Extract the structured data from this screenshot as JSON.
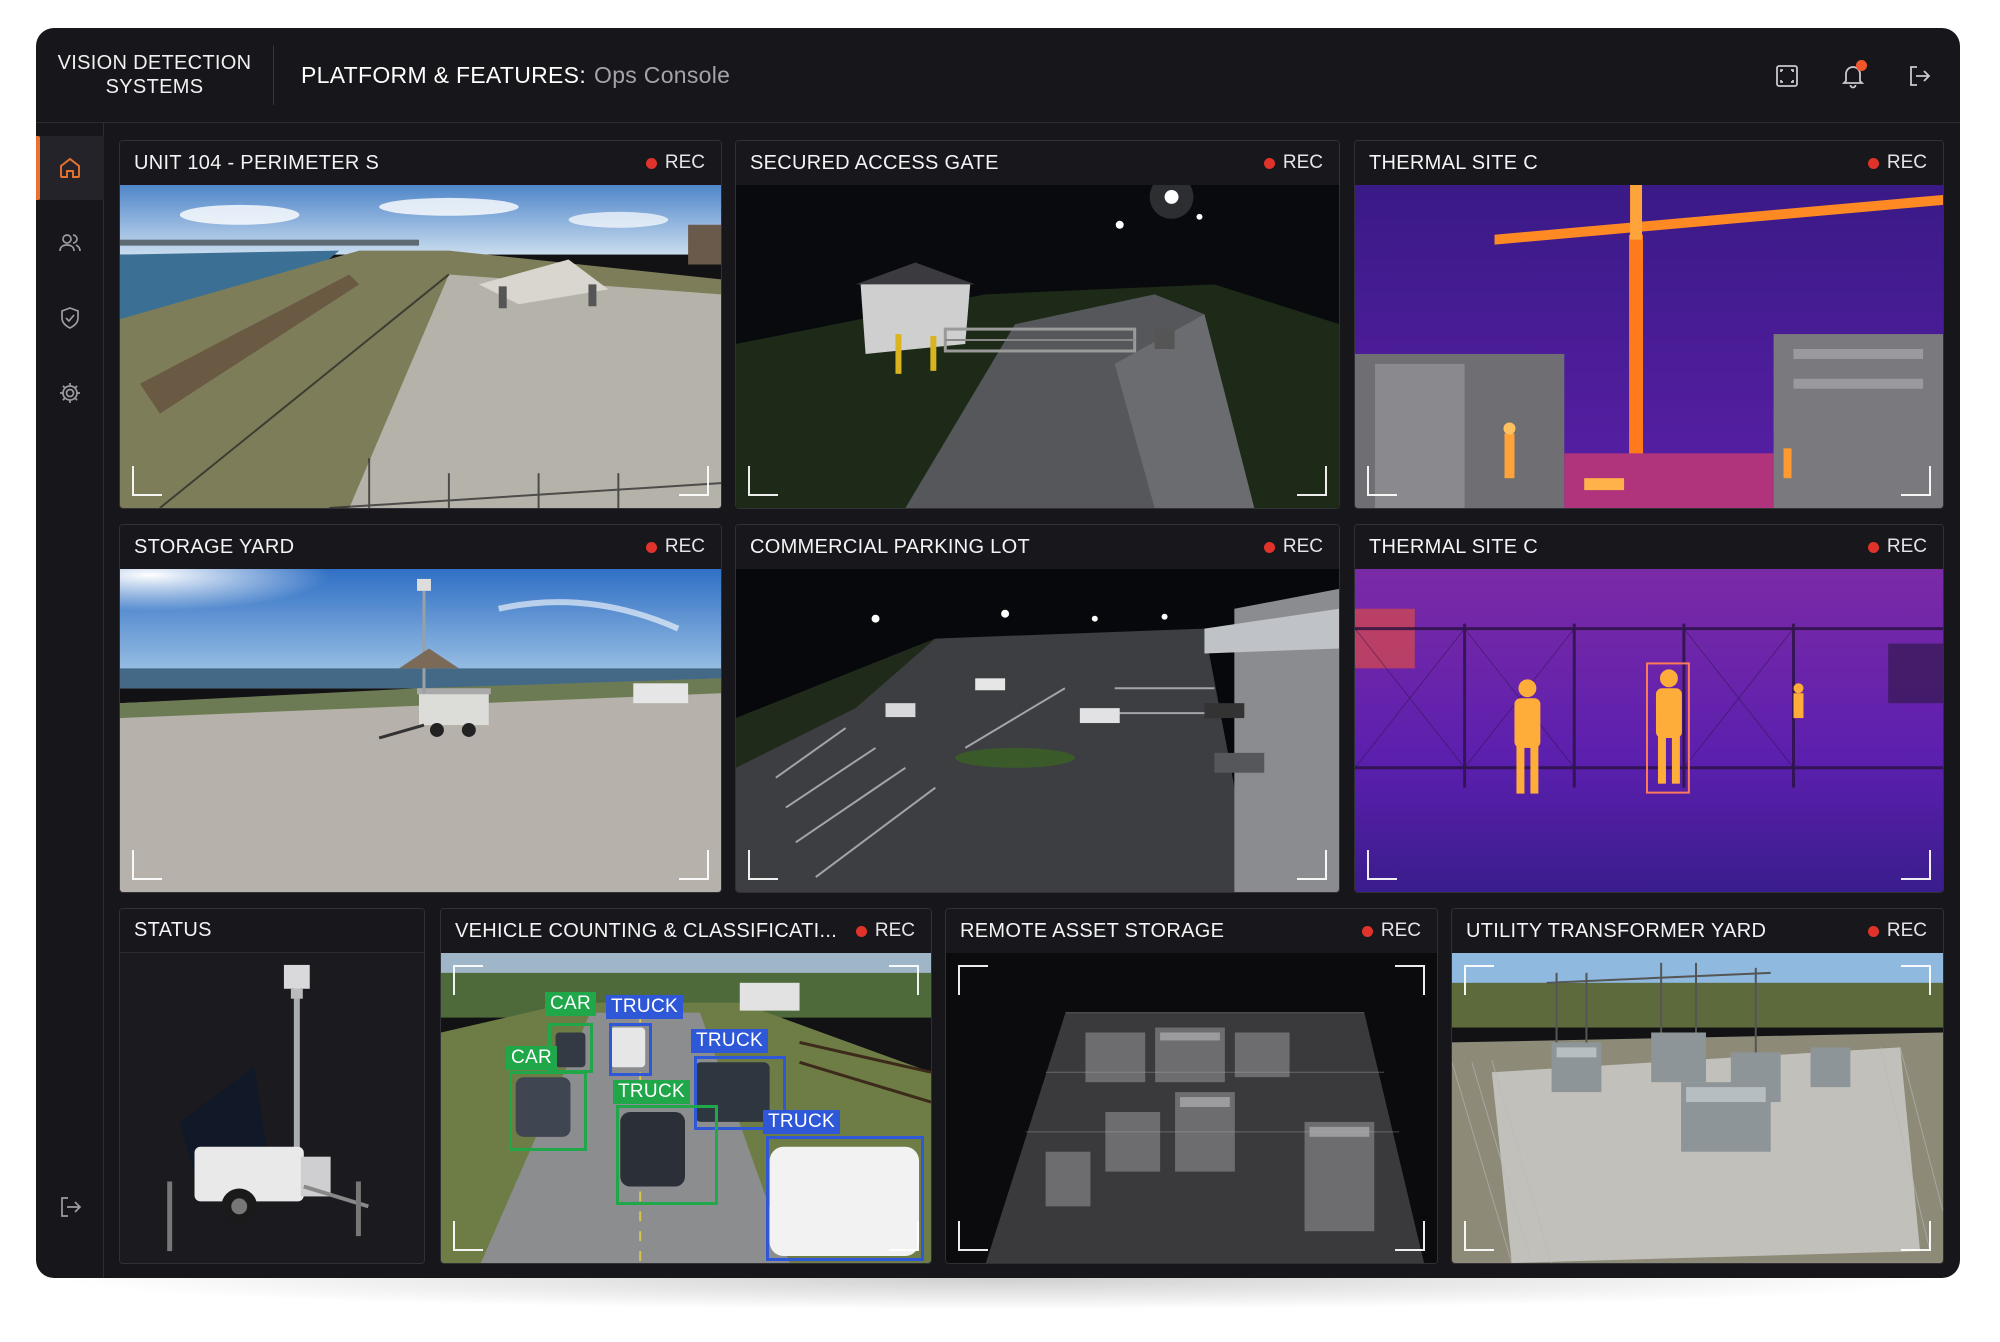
{
  "brand": {
    "line1": "VISION DETECTION",
    "line2": "SYSTEMS"
  },
  "header": {
    "title_strong": "PLATFORM & FEATURES:",
    "title_light": "Ops Console",
    "icons": [
      "fullscreen-icon",
      "bell-icon",
      "logout-icon"
    ],
    "notification_dot_color": "#f2572b"
  },
  "sidebar": {
    "items": [
      {
        "icon": "home-icon",
        "active": true
      },
      {
        "icon": "users-icon",
        "active": false
      },
      {
        "icon": "shield-icon",
        "active": false
      },
      {
        "icon": "gear-icon",
        "active": false
      }
    ],
    "bottom_icon": "logout-icon"
  },
  "accent_color": "#e8722f",
  "rec_label": "REC",
  "rec_color": "#e0332c",
  "panels": [
    {
      "title": "UNIT 104 - PERIMETER S",
      "rec": true,
      "scene": "waterfront perimeter with pavilion and fence"
    },
    {
      "title": "SECURED ACCESS GATE",
      "rec": true,
      "scene": "night access gate with guard booth"
    },
    {
      "title": "THERMAL SITE C",
      "rec": true,
      "scene": "thermal view of construction crane"
    },
    {
      "title": "STORAGE YARD",
      "rec": true,
      "scene": "gravel yard with mobile surveillance trailer"
    },
    {
      "title": "COMMERCIAL PARKING LOT",
      "rec": true,
      "scene": "night parking lot aerial view"
    },
    {
      "title": "THERMAL SITE C",
      "rec": true,
      "scene": "thermal view of people at fence"
    },
    {
      "title": "STATUS",
      "rec": false,
      "scene": "surveillance trailer unit"
    },
    {
      "title": "VEHICLE COUNTING & CLASSIFICATI...",
      "rec": true,
      "scene": "road with detected vehicles"
    },
    {
      "title": "REMOTE ASSET STORAGE",
      "rec": true,
      "scene": "night infrared storage area"
    },
    {
      "title": "UTILITY TRANSFORMER YARD",
      "rec": true,
      "scene": "electrical substation"
    }
  ],
  "detections": [
    {
      "label": "CAR",
      "class": "car",
      "color": "#1fa74a"
    },
    {
      "label": "TRUCK",
      "class": "truck",
      "color": "#2e58d8"
    },
    {
      "label": "CAR",
      "class": "car",
      "color": "#1fa74a"
    },
    {
      "label": "TRUCK",
      "class": "truck",
      "color": "#2e58d8"
    },
    {
      "label": "TRUCK",
      "class": "truck",
      "color": "#1fa74a"
    },
    {
      "label": "TRUCK",
      "class": "truck",
      "color": "#2e58d8"
    }
  ]
}
